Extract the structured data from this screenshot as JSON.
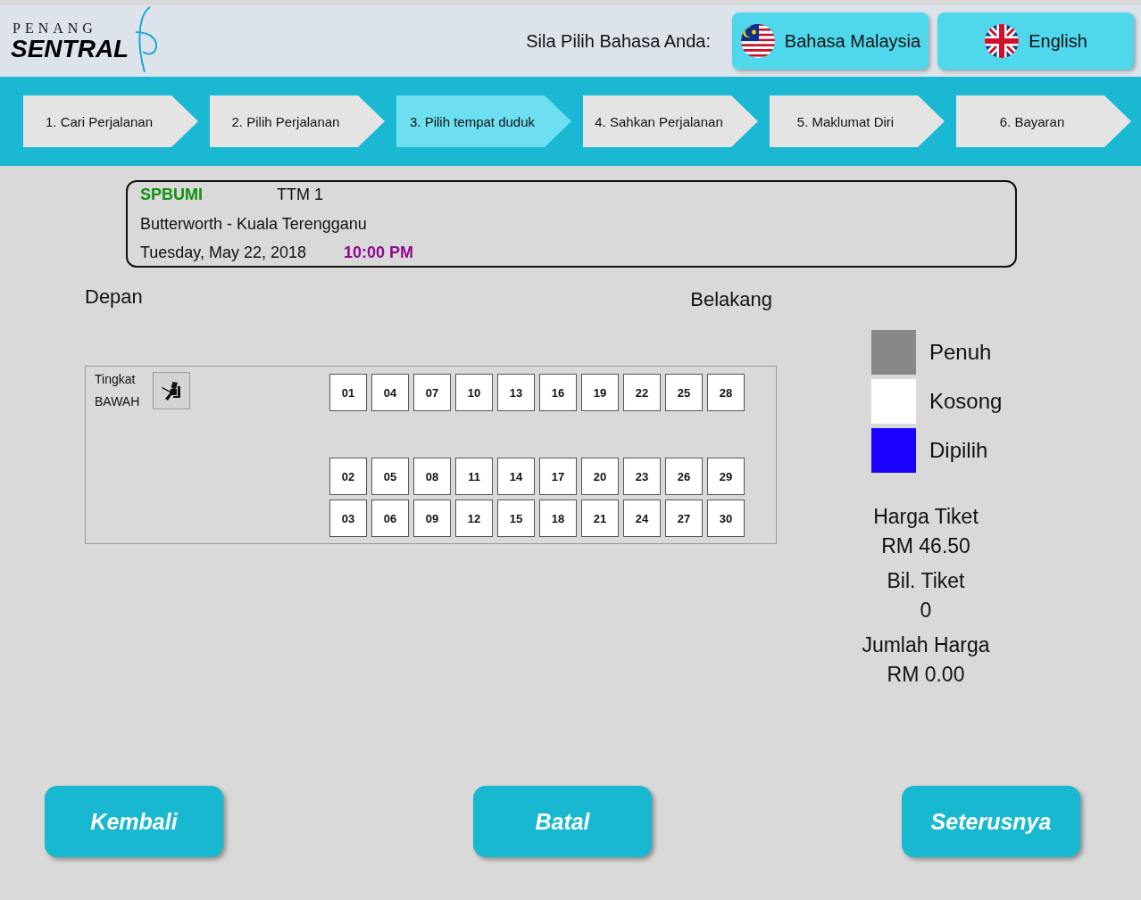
{
  "header": {
    "logo_top": "PENANG",
    "logo_main": "SENTRAL",
    "language_prompt": "Sila Pilih Bahasa Anda:",
    "languages": [
      {
        "label": "Bahasa Malaysia",
        "kind": "malaysia"
      },
      {
        "label": "English",
        "kind": "uk"
      }
    ]
  },
  "steps": [
    {
      "label": "1. Cari Perjalanan",
      "selected": false
    },
    {
      "label": "2. Pilih Perjalanan",
      "selected": false
    },
    {
      "label": "3. Pilih tempat duduk",
      "selected": true
    },
    {
      "label": "4. Sahkan Perjalanan",
      "selected": false
    },
    {
      "label": "5. Maklumat Diri",
      "selected": false
    },
    {
      "label": "6. Bayaran",
      "selected": false
    }
  ],
  "trip": {
    "operator": "SPBUMI",
    "bus": "TTM 1",
    "route": "Butterworth - Kuala Terengganu",
    "date": "Tuesday, May 22, 2018",
    "time": "10:00 PM"
  },
  "front_label": "Depan",
  "back_label": "Belakang",
  "deck": {
    "label_top": "Tingkat",
    "label_bottom": "BAWAH",
    "rows": [
      [
        {
          "number": "01",
          "taken": false,
          "selected": false
        },
        {
          "number": "04",
          "taken": false,
          "selected": false
        },
        {
          "number": "07",
          "taken": false,
          "selected": false
        },
        {
          "number": "10",
          "taken": false,
          "selected": false
        },
        {
          "number": "13",
          "taken": false,
          "selected": false
        },
        {
          "number": "16",
          "taken": false,
          "selected": false
        },
        {
          "number": "19",
          "taken": false,
          "selected": false
        },
        {
          "number": "22",
          "taken": false,
          "selected": false
        },
        {
          "number": "25",
          "taken": false,
          "selected": false
        },
        {
          "number": "28",
          "taken": false,
          "selected": false
        }
      ],
      [
        {
          "number": "02",
          "taken": false,
          "selected": false
        },
        {
          "number": "05",
          "taken": false,
          "selected": false
        },
        {
          "number": "08",
          "taken": false,
          "selected": false
        },
        {
          "number": "11",
          "taken": false,
          "selected": false
        },
        {
          "number": "14",
          "taken": false,
          "selected": false
        },
        {
          "number": "17",
          "taken": false,
          "selected": false
        },
        {
          "number": "20",
          "taken": false,
          "selected": false
        },
        {
          "number": "23",
          "taken": false,
          "selected": false
        },
        {
          "number": "26",
          "taken": false,
          "selected": false
        },
        {
          "number": "29",
          "taken": false,
          "selected": false
        }
      ],
      [
        {
          "number": "03",
          "taken": false,
          "selected": false
        },
        {
          "number": "06",
          "taken": false,
          "selected": false
        },
        {
          "number": "09",
          "taken": false,
          "selected": false
        },
        {
          "number": "12",
          "taken": false,
          "selected": false
        },
        {
          "number": "15",
          "taken": false,
          "selected": false
        },
        {
          "number": "18",
          "taken": false,
          "selected": false
        },
        {
          "number": "21",
          "taken": false,
          "selected": false
        },
        {
          "number": "24",
          "taken": false,
          "selected": false
        },
        {
          "number": "27",
          "taken": false,
          "selected": false
        },
        {
          "number": "30",
          "taken": false,
          "selected": false
        }
      ]
    ]
  },
  "legend": [
    {
      "label": "Penuh",
      "color": "#888888"
    },
    {
      "label": "Kosong",
      "color": "#ffffff"
    },
    {
      "label": "Dipilih",
      "color": "#1a00ff"
    }
  ],
  "summary": [
    {
      "label": "Harga Tiket",
      "value": "RM 46.50"
    },
    {
      "label": "Bil. Tiket",
      "value": "0"
    },
    {
      "label": "Jumlah Harga",
      "value": "RM 0.00"
    }
  ],
  "buttons": [
    "Kembali",
    "Batal",
    "Seterusnya"
  ]
}
